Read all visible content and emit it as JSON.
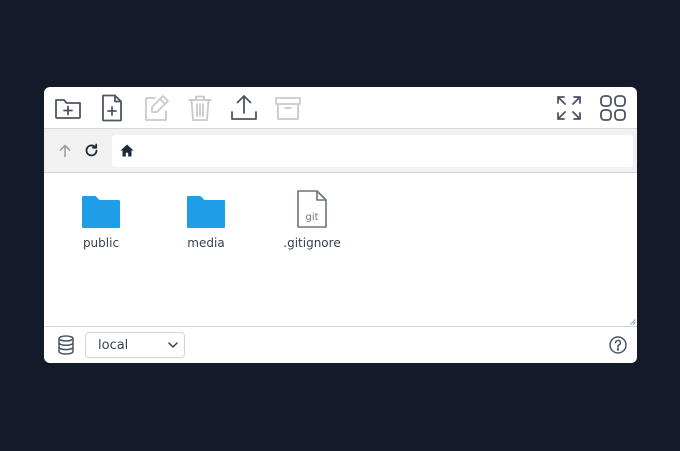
{
  "toolbar": {
    "buttons": [
      {
        "icon": "new-folder-icon",
        "enabled": true
      },
      {
        "icon": "new-file-icon",
        "enabled": true
      },
      {
        "icon": "rename-icon",
        "enabled": false
      },
      {
        "icon": "delete-icon",
        "enabled": false
      },
      {
        "icon": "upload-icon",
        "enabled": true
      },
      {
        "icon": "archive-icon",
        "enabled": false
      },
      {
        "icon": "fullscreen-icon",
        "enabled": true
      },
      {
        "icon": "grid-view-icon",
        "enabled": true
      }
    ]
  },
  "address": {
    "up_icon": "arrow-up-icon",
    "refresh_icon": "refresh-icon",
    "home_icon": "home-icon"
  },
  "items": [
    {
      "name": "public",
      "type": "folder"
    },
    {
      "name": "media",
      "type": "folder"
    },
    {
      "name": ".gitignore",
      "type": "file",
      "badge": "git"
    }
  ],
  "status": {
    "storage_icon": "database-icon",
    "storage_value": "local",
    "help_icon": "help-icon"
  },
  "colors": {
    "background": "#131a2a",
    "folder": "#1f9de6",
    "icon": "#4b5563",
    "disabled": "#c7c9cc"
  }
}
